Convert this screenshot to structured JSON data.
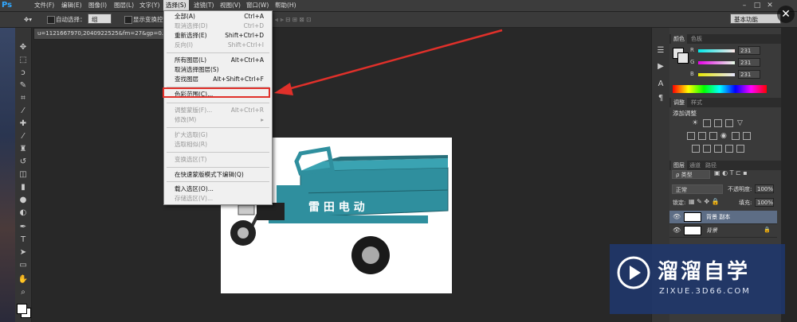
{
  "app": {
    "logo": "Ps"
  },
  "menubar": {
    "items": [
      "文件(F)",
      "编辑(E)",
      "图像(I)",
      "图层(L)",
      "文字(Y)",
      "选择(S)",
      "滤镜(T)",
      "视图(V)",
      "窗口(W)",
      "帮助(H)"
    ],
    "active": "选择(S)"
  },
  "options_bar": {
    "auto_select_label": "自动选择：",
    "auto_select_value": "组",
    "show_transform_label": "显示变换控件",
    "workspace_value": "基本功能"
  },
  "document": {
    "tab_title": "u=1121667970,2040922525&fm=27&gp=0.jpg"
  },
  "select_menu": {
    "items": [
      {
        "label": "全部(A)",
        "shortcut": "Ctrl+A",
        "disabled": false
      },
      {
        "label": "取消选择(D)",
        "shortcut": "Ctrl+D",
        "disabled": true
      },
      {
        "label": "重新选择(E)",
        "shortcut": "Shift+Ctrl+D",
        "disabled": false
      },
      {
        "label": "反向(I)",
        "shortcut": "Shift+Ctrl+I",
        "disabled": true
      },
      {
        "label": "所有图层(L)",
        "shortcut": "Alt+Ctrl+A",
        "disabled": false
      },
      {
        "label": "取消选择图层(S)",
        "shortcut": "",
        "disabled": false
      },
      {
        "label": "查找图层",
        "shortcut": "Alt+Shift+Ctrl+F",
        "disabled": false
      },
      {
        "label": "色彩范围(C)...",
        "shortcut": "",
        "disabled": false
      },
      {
        "label": "调整蒙版(F)...",
        "shortcut": "Alt+Ctrl+R",
        "disabled": true
      },
      {
        "label": "修改(M)",
        "shortcut": "▸",
        "disabled": true
      },
      {
        "label": "扩大选取(G)",
        "shortcut": "",
        "disabled": true
      },
      {
        "label": "选取相似(R)",
        "shortcut": "",
        "disabled": true
      },
      {
        "label": "变换选区(T)",
        "shortcut": "",
        "disabled": true
      },
      {
        "label": "在快速蒙版模式下编辑(Q)",
        "shortcut": "",
        "disabled": false
      },
      {
        "label": "载入选区(O)...",
        "shortcut": "",
        "disabled": false
      },
      {
        "label": "存储选区(V)...",
        "shortcut": "",
        "disabled": true
      }
    ],
    "highlighted": "色彩范围(C)..."
  },
  "color_panel": {
    "tabs": [
      "颜色",
      "色板"
    ],
    "channels": [
      {
        "name": "R",
        "value": "231"
      },
      {
        "name": "G",
        "value": "231"
      },
      {
        "name": "B",
        "value": "231"
      }
    ]
  },
  "adjustments_panel": {
    "tabs": [
      "调整",
      "样式"
    ],
    "title": "添加调整"
  },
  "layers_panel": {
    "tabs": [
      "图层",
      "通道",
      "路径"
    ],
    "filter_label": "ρ 类型",
    "blend_mode": "正常",
    "opacity_label": "不透明度:",
    "opacity_value": "100%",
    "lock_label": "锁定:",
    "fill_label": "填充:",
    "fill_value": "100%",
    "layers": [
      {
        "name": "背景 副本",
        "selected": true
      },
      {
        "name": "背景",
        "selected": false
      }
    ]
  },
  "canvas_image": {
    "vehicle_text": "雷 田 电 动"
  },
  "watermark": {
    "title": "溜溜自学",
    "url": "ZIXUE.3D66.COM"
  },
  "colors": {
    "highlight": "#e0302a",
    "accent_ps": "#31a8ff",
    "vehicle": "#2f8f9e"
  }
}
